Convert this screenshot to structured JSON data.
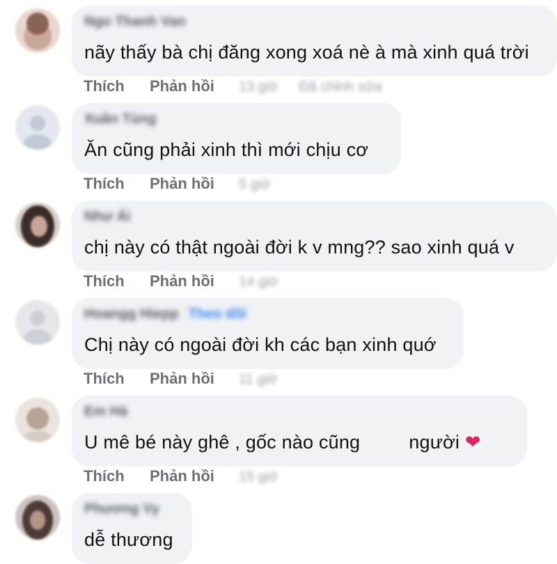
{
  "comments": [
    {
      "author": "Ngo Thanh Van",
      "text": "nãy thấy bà chị đăng xong xoá nè à mà xinh quá trời",
      "like": "Thích",
      "reply": "Phản hồi",
      "time": "13 giờ",
      "edited": "Đã chỉnh sửa",
      "avatar_color": "#c9a79a"
    },
    {
      "author": "Xuân Tùng",
      "text": "Ăn cũng phải xinh thì mới chịu cơ",
      "like": "Thích",
      "reply": "Phản hồi",
      "time": "5 giờ",
      "avatar_color": "#dfe4ef"
    },
    {
      "author": "Như Ái",
      "text": "chị này có thật ngoài đời k v mng?? sao xinh quá v",
      "like": "Thích",
      "reply": "Phản hồi",
      "time": "14 giờ",
      "avatar_color": "#5a4a46"
    },
    {
      "author": "Hoangg Hiepp",
      "follow": "Theo dõi",
      "text": "Chị này có ngoài đời kh các bạn xinh quớ",
      "like": "Thích",
      "reply": "Phản hồi",
      "time": "11 giờ",
      "avatar_color": "#dedfe3"
    },
    {
      "author": "Em Hà",
      "text": "U mê bé này ghê , gốc nào cũng",
      "text_end": "người",
      "like": "Thích",
      "reply": "Phản hồi",
      "time": "15 giờ",
      "avatar_color": "#b8a399"
    },
    {
      "author": "Phương Vy",
      "text": "dễ thương",
      "avatar_color": "#6e5c5a"
    }
  ],
  "heart": "❤"
}
